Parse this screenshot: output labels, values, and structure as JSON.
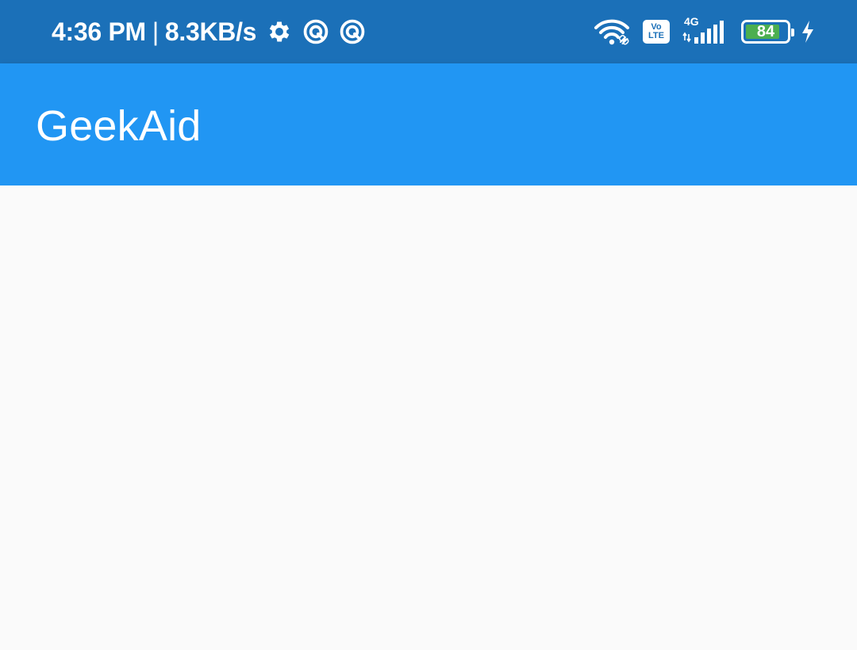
{
  "status_bar": {
    "time": "4:36 PM",
    "separator": "|",
    "network_speed": "8.3KB/s",
    "left_icons": [
      "gear-icon",
      "notification-app-icon",
      "notification-app-icon"
    ],
    "volte_top": "Vo",
    "volte_bottom": "LTE",
    "network_type": "4G",
    "battery_level": "84",
    "battery_fill": 0.84,
    "charging": true,
    "colors": {
      "background": "#1b70b8",
      "battery_fill": "#4caf50"
    }
  },
  "app_bar": {
    "title": "GeekAid",
    "color": "#2196f3"
  },
  "content": {
    "background": "#fafafa"
  }
}
